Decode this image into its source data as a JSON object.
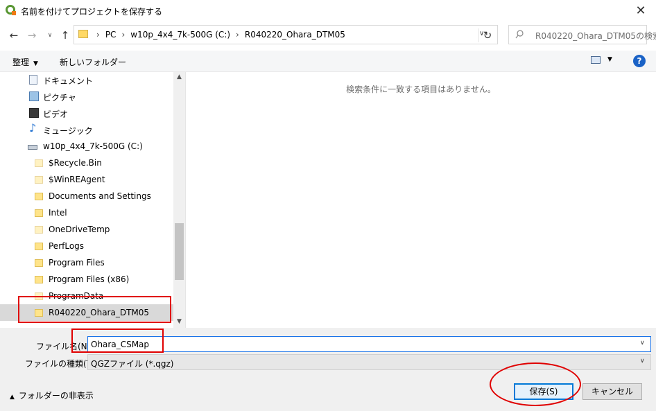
{
  "window": {
    "title": "名前を付けてプロジェクトを保存する"
  },
  "address": {
    "crumbs": [
      "PC",
      "w10p_4x4_7k-500G (C:)",
      "R040220_Ohara_DTM05"
    ]
  },
  "search": {
    "placeholder": "R040220_Ohara_DTM05の検索"
  },
  "toolbar": {
    "organize": "整理",
    "new_folder": "新しいフォルダー"
  },
  "tree": {
    "items": [
      {
        "label": "ドキュメント",
        "icon": "documents-icon"
      },
      {
        "label": "ピクチャ",
        "icon": "pictures-icon"
      },
      {
        "label": "ビデオ",
        "icon": "video-icon"
      },
      {
        "label": "ミュージック",
        "icon": "music-icon"
      },
      {
        "label": "w10p_4x4_7k-500G (C:)",
        "icon": "drive-icon"
      },
      {
        "label": "$Recycle.Bin",
        "icon": "folder-icon"
      },
      {
        "label": "$WinREAgent",
        "icon": "folder-icon"
      },
      {
        "label": "Documents and Settings",
        "icon": "shortcut-folder-icon"
      },
      {
        "label": "Intel",
        "icon": "folder-icon"
      },
      {
        "label": "OneDriveTemp",
        "icon": "folder-icon"
      },
      {
        "label": "PerfLogs",
        "icon": "folder-icon"
      },
      {
        "label": "Program Files",
        "icon": "folder-icon"
      },
      {
        "label": "Program Files (x86)",
        "icon": "folder-icon"
      },
      {
        "label": "ProgramData",
        "icon": "folder-icon"
      },
      {
        "label": "R040220_Ohara_DTM05",
        "icon": "folder-icon"
      }
    ],
    "selected": "R040220_Ohara_DTM05"
  },
  "content": {
    "empty_message": "検索条件に一致する項目はありません。"
  },
  "form": {
    "filename_label": "ファイル名(N):",
    "filename_value": "Ohara_CSMap",
    "filetype_label": "ファイルの種類(T):",
    "filetype_value": "QGZファイル (*.qgz)"
  },
  "footer": {
    "hide_folders": "フォルダーの非表示",
    "save": "保存(S)",
    "cancel": "キャンセル"
  },
  "colors": {
    "accent": "#0078d7",
    "annotation": "#e00000",
    "selected_row": "#d9d9d9"
  }
}
